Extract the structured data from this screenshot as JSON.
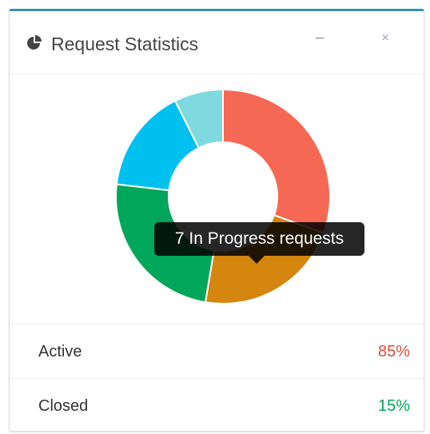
{
  "widget": {
    "title": "Request Statistics",
    "icon": "pie-chart-icon",
    "minimize_icon": "minus-icon",
    "minimize_label": "−",
    "close_icon": "close-icon",
    "close_label": "×"
  },
  "chart_data": {
    "type": "pie",
    "donut": true,
    "title": "",
    "slices": [
      {
        "value": 29,
        "color": "#f56954"
      },
      {
        "value": 21,
        "color": "#d4860f"
      },
      {
        "value": 23,
        "color": "#00a65a"
      },
      {
        "value": 15,
        "color": "#00c0ef"
      },
      {
        "value": 7,
        "color": "#7fd9df"
      }
    ],
    "tooltip": "7 In Progress requests"
  },
  "stats": [
    {
      "label": "Active",
      "value": "85%",
      "color": "#dd4b39"
    },
    {
      "label": "Closed",
      "value": "15%",
      "color": "#00a65a"
    }
  ]
}
